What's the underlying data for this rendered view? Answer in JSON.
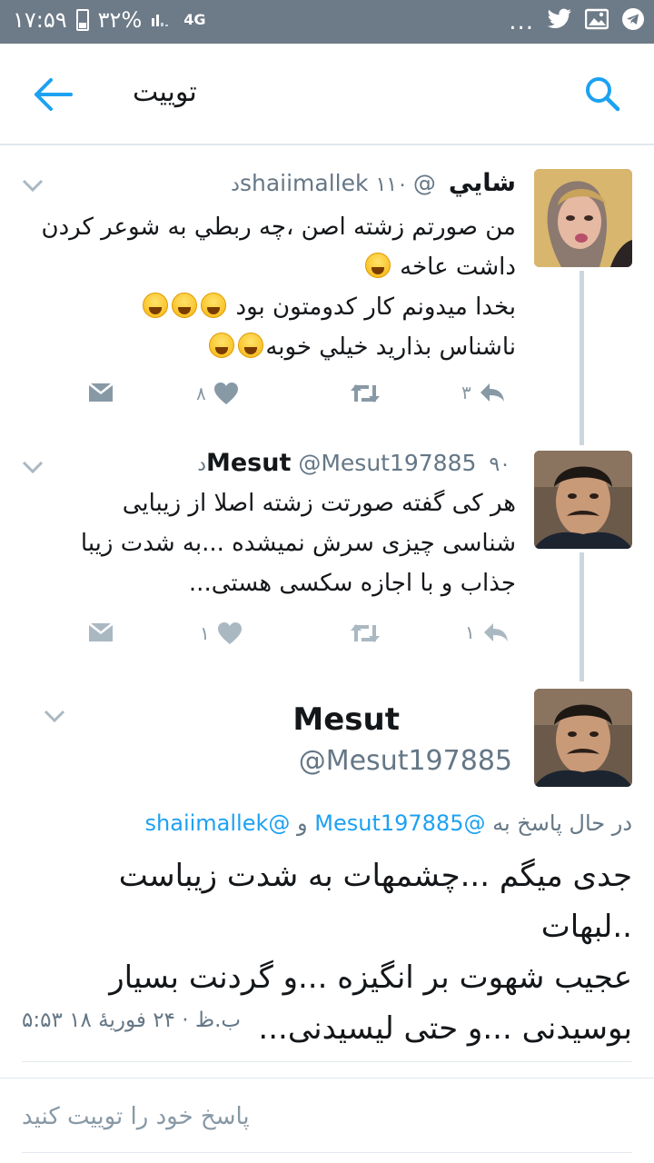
{
  "status_bar": {
    "time": "۱۷:۵۹",
    "battery": "۳۲%",
    "network": "4G",
    "more": "...",
    "icons": [
      "twitter-icon",
      "image-icon",
      "telegram-icon"
    ]
  },
  "app_bar": {
    "title": "توییت",
    "back_icon": "arrow-left-icon",
    "search_icon": "search-icon"
  },
  "tweets": [
    {
      "name": "شايي",
      "handle": "@shaiimallek",
      "time": "۱۱۰د",
      "lines": [
        "من صورتم زشته اصن ،چه ربطي به شوعر كردن",
        "داشت عاخه",
        "بخدا ميدونم كار كدومتون بود",
        "ناشناس بذاريد خيلي خوبه"
      ],
      "emoji": "face-with-tears-of-joy",
      "reply_count": "۳",
      "retweet_count": "",
      "like_count": "۸"
    },
    {
      "name": "Mesut",
      "handle": "@Mesut197885",
      "time": "۹۰د",
      "lines": [
        "هر کی گفته صورتت زشته اصلا از زیبایی",
        "شناسی چیزی سرش نمیشده ...به شدت زیبا",
        "جذاب و با اجازه سکسی هستی..."
      ],
      "reply_count": "۱",
      "retweet_count": "",
      "like_count": "۱"
    }
  ],
  "focused_tweet": {
    "name": "Mesut",
    "handle": "@Mesut197885",
    "replying_prefix": "در حال پاسخ به",
    "replying_to": [
      "@Mesut197885",
      "@shaiimallek"
    ],
    "replying_joiner": "و",
    "lines": [
      "جدی میگم ...چشمهات به شدت زیباست ..لبهات",
      "عجیب شهوت بر انگیزه ...و گردنت بسیار",
      "بوسیدنی ...و حتی لیسیدنی..."
    ],
    "timestamp": "۵:۵۳ ب.ظ · ۲۴ فوريهٔ ۱۸"
  },
  "reply_placeholder": "پاسخ خود را توییت کنید",
  "colors": {
    "status_bar": "#6d7a87",
    "accent": "#1da1f2",
    "muted": "#657786",
    "icon_gray": "#8899a6"
  }
}
